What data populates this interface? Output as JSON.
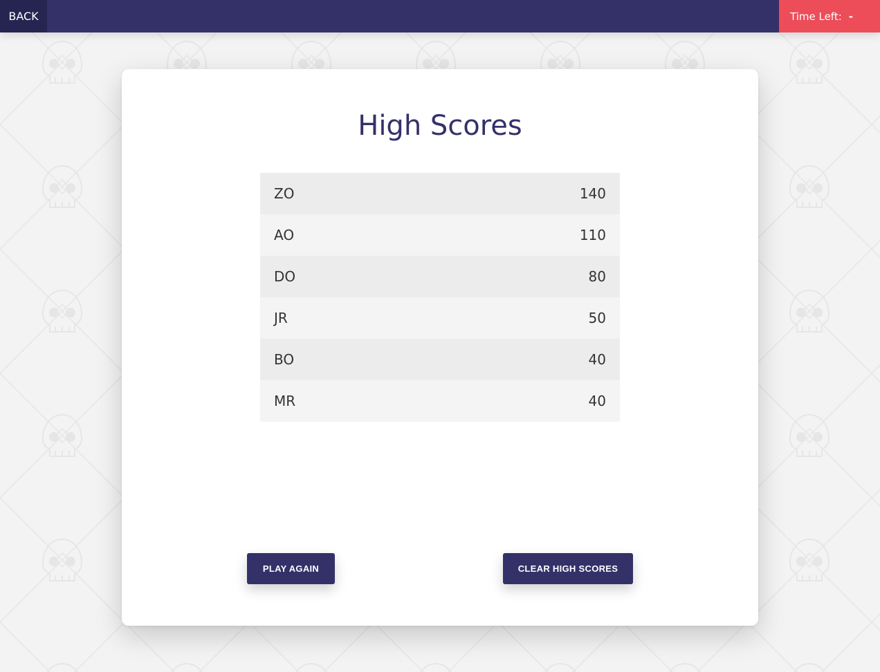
{
  "header": {
    "back_label": "BACK",
    "timer_label": "Time Left:",
    "timer_value": "-"
  },
  "main": {
    "title": "High Scores",
    "scores": [
      {
        "name": "ZO",
        "score": "140"
      },
      {
        "name": "AO",
        "score": "110"
      },
      {
        "name": "DO",
        "score": "80"
      },
      {
        "name": "JR",
        "score": "50"
      },
      {
        "name": "BO",
        "score": "40"
      },
      {
        "name": "MR",
        "score": "40"
      }
    ],
    "play_again_label": "PLAY AGAIN",
    "clear_label": "CLEAR HIGH SCORES"
  },
  "background": {
    "pattern_icon": "skull-icon"
  },
  "colors": {
    "navy": "#343169",
    "navy_dark": "#262451",
    "timer_red": "#ed4c59",
    "page_bg": "#f3f3f3"
  }
}
